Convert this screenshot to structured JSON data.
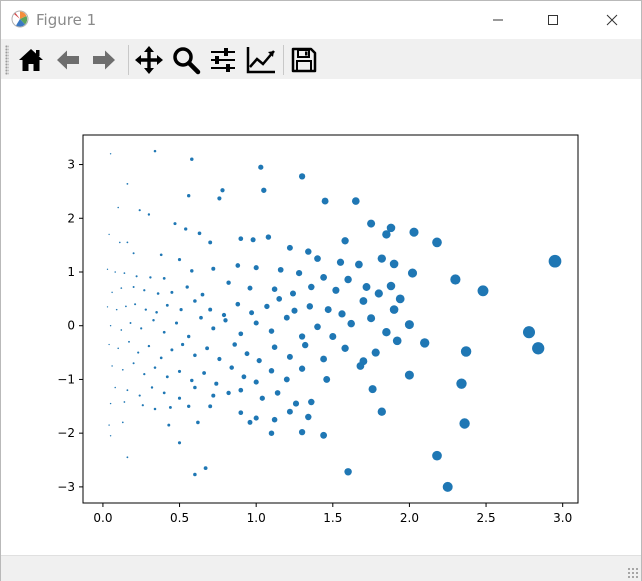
{
  "window": {
    "title": "Figure 1",
    "controls": [
      "minimize",
      "maximize",
      "close"
    ]
  },
  "toolbar": {
    "buttons": [
      {
        "name": "home",
        "icon": "home-icon",
        "tooltip": "Reset original view"
      },
      {
        "name": "back",
        "icon": "arrow-left-icon",
        "tooltip": "Back to previous view"
      },
      {
        "name": "forward",
        "icon": "arrow-right-icon",
        "tooltip": "Forward to next view"
      },
      {
        "name": "pan",
        "icon": "move-icon",
        "tooltip": "Pan axes"
      },
      {
        "name": "zoom",
        "icon": "magnifier-icon",
        "tooltip": "Zoom to rectangle"
      },
      {
        "name": "configure",
        "icon": "sliders-icon",
        "tooltip": "Configure subplots"
      },
      {
        "name": "edit",
        "icon": "line-chart-icon",
        "tooltip": "Edit axis"
      },
      {
        "name": "save",
        "icon": "floppy-disk-icon",
        "tooltip": "Save the figure"
      }
    ]
  },
  "colors": {
    "marker": "#1f77b4",
    "axes": "#000000",
    "toolbar_icons": "#000000",
    "disabled_icons": "#6e6e6e"
  },
  "chart_data": {
    "type": "scatter",
    "title": "",
    "xlabel": "",
    "ylabel": "",
    "xlim": [
      -0.13,
      3.1
    ],
    "ylim": [
      -3.3,
      3.55
    ],
    "xticks": [
      0.0,
      0.5,
      1.0,
      1.5,
      2.0,
      2.5,
      3.0
    ],
    "xtick_labels": [
      "0.0",
      "0.5",
      "1.0",
      "1.5",
      "2.0",
      "2.5",
      "3.0"
    ],
    "yticks": [
      -3,
      -2,
      -1,
      0,
      1,
      2,
      3
    ],
    "ytick_labels": [
      "−3",
      "−2",
      "−1",
      "0",
      "1",
      "2",
      "3"
    ],
    "grid": false,
    "marker_size_scales_with_x": true,
    "points": [
      [
        0.05,
        3.2
      ],
      [
        0.34,
        3.25
      ],
      [
        0.58,
        3.1
      ],
      [
        1.03,
        2.95
      ],
      [
        1.3,
        2.78
      ],
      [
        0.16,
        2.64
      ],
      [
        0.78,
        2.52
      ],
      [
        1.05,
        2.52
      ],
      [
        0.56,
        2.42
      ],
      [
        0.76,
        2.37
      ],
      [
        1.45,
        2.32
      ],
      [
        1.65,
        2.32
      ],
      [
        0.1,
        2.2
      ],
      [
        0.24,
        2.15
      ],
      [
        0.3,
        2.07
      ],
      [
        0.47,
        1.9
      ],
      [
        0.54,
        1.8
      ],
      [
        0.63,
        1.72
      ],
      [
        1.75,
        1.9
      ],
      [
        1.88,
        1.82
      ],
      [
        2.03,
        1.74
      ],
      [
        1.85,
        1.7
      ],
      [
        1.58,
        1.58
      ],
      [
        2.18,
        1.55
      ],
      [
        0.11,
        1.55
      ],
      [
        0.16,
        1.55
      ],
      [
        0.04,
        1.7
      ],
      [
        0.2,
        1.35
      ],
      [
        0.38,
        1.32
      ],
      [
        0.5,
        1.23
      ],
      [
        0.7,
        1.55
      ],
      [
        0.9,
        1.62
      ],
      [
        0.98,
        1.6
      ],
      [
        1.08,
        1.65
      ],
      [
        1.22,
        1.45
      ],
      [
        1.34,
        1.38
      ],
      [
        1.4,
        1.25
      ],
      [
        1.55,
        1.18
      ],
      [
        1.67,
        1.14
      ],
      [
        1.82,
        1.25
      ],
      [
        1.9,
        1.15
      ],
      [
        2.95,
        1.2
      ],
      [
        0.03,
        1.05
      ],
      [
        0.08,
        1.0
      ],
      [
        0.14,
        0.98
      ],
      [
        0.22,
        0.92
      ],
      [
        0.31,
        0.9
      ],
      [
        0.4,
        0.88
      ],
      [
        0.58,
        1.02
      ],
      [
        0.72,
        1.06
      ],
      [
        0.88,
        1.12
      ],
      [
        1.0,
        1.08
      ],
      [
        1.16,
        1.04
      ],
      [
        1.28,
        0.98
      ],
      [
        1.44,
        0.9
      ],
      [
        1.6,
        0.86
      ],
      [
        2.02,
        0.98
      ],
      [
        2.3,
        0.86
      ],
      [
        0.06,
        0.62
      ],
      [
        0.12,
        0.7
      ],
      [
        0.2,
        0.72
      ],
      [
        0.27,
        0.66
      ],
      [
        0.36,
        0.6
      ],
      [
        0.45,
        0.62
      ],
      [
        0.55,
        0.72
      ],
      [
        0.65,
        0.58
      ],
      [
        0.82,
        0.8
      ],
      [
        0.96,
        0.7
      ],
      [
        1.12,
        0.68
      ],
      [
        1.24,
        0.6
      ],
      [
        1.36,
        0.72
      ],
      [
        1.52,
        0.66
      ],
      [
        1.72,
        0.72
      ],
      [
        1.88,
        0.74
      ],
      [
        1.94,
        0.5
      ],
      [
        2.48,
        0.65
      ],
      [
        0.03,
        0.35
      ],
      [
        0.09,
        0.3
      ],
      [
        0.15,
        0.36
      ],
      [
        0.21,
        0.4
      ],
      [
        0.28,
        0.3
      ],
      [
        0.35,
        0.25
      ],
      [
        0.42,
        0.38
      ],
      [
        0.51,
        0.3
      ],
      [
        0.6,
        0.46
      ],
      [
        0.7,
        0.3
      ],
      [
        0.79,
        0.2
      ],
      [
        0.88,
        0.4
      ],
      [
        0.97,
        0.24
      ],
      [
        1.07,
        0.36
      ],
      [
        1.15,
        0.5
      ],
      [
        1.25,
        0.28
      ],
      [
        1.35,
        0.36
      ],
      [
        1.47,
        0.3
      ],
      [
        1.56,
        0.22
      ],
      [
        1.7,
        0.46
      ],
      [
        1.8,
        0.6
      ],
      [
        1.9,
        0.3
      ],
      [
        2.0,
        0.02
      ],
      [
        0.05,
        0.0
      ],
      [
        0.12,
        -0.08
      ],
      [
        0.18,
        0.05
      ],
      [
        0.25,
        -0.05
      ],
      [
        0.33,
        0.1
      ],
      [
        0.4,
        -0.12
      ],
      [
        0.48,
        0.05
      ],
      [
        0.56,
        -0.2
      ],
      [
        0.64,
        0.15
      ],
      [
        0.72,
        -0.05
      ],
      [
        0.8,
        0.1
      ],
      [
        0.9,
        -0.15
      ],
      [
        1.0,
        0.05
      ],
      [
        1.1,
        -0.1
      ],
      [
        1.2,
        0.15
      ],
      [
        1.3,
        -0.2
      ],
      [
        1.4,
        -0.02
      ],
      [
        1.5,
        -0.2
      ],
      [
        1.62,
        0.04
      ],
      [
        1.75,
        0.14
      ],
      [
        1.85,
        -0.12
      ],
      [
        2.1,
        -0.32
      ],
      [
        2.78,
        -0.12
      ],
      [
        0.04,
        -0.35
      ],
      [
        0.1,
        -0.42
      ],
      [
        0.17,
        -0.3
      ],
      [
        0.23,
        -0.5
      ],
      [
        0.3,
        -0.38
      ],
      [
        0.38,
        -0.6
      ],
      [
        0.45,
        -0.45
      ],
      [
        0.52,
        -0.35
      ],
      [
        0.6,
        -0.55
      ],
      [
        0.68,
        -0.42
      ],
      [
        0.76,
        -0.62
      ],
      [
        0.86,
        -0.35
      ],
      [
        0.94,
        -0.52
      ],
      [
        1.02,
        -0.65
      ],
      [
        1.12,
        -0.4
      ],
      [
        1.22,
        -0.58
      ],
      [
        1.32,
        -0.36
      ],
      [
        1.44,
        -0.62
      ],
      [
        1.58,
        -0.42
      ],
      [
        1.7,
        -0.66
      ],
      [
        1.78,
        -0.5
      ],
      [
        1.92,
        -0.28
      ],
      [
        2.37,
        -0.48
      ],
      [
        2.84,
        -0.42
      ],
      [
        0.06,
        -0.75
      ],
      [
        0.13,
        -0.82
      ],
      [
        0.2,
        -0.7
      ],
      [
        0.27,
        -0.9
      ],
      [
        0.34,
        -0.78
      ],
      [
        0.42,
        -0.95
      ],
      [
        0.5,
        -0.85
      ],
      [
        0.58,
        -1.02
      ],
      [
        0.66,
        -0.88
      ],
      [
        0.74,
        -1.08
      ],
      [
        0.84,
        -0.78
      ],
      [
        0.92,
        -0.95
      ],
      [
        1.0,
        -1.05
      ],
      [
        1.1,
        -0.84
      ],
      [
        1.2,
        -1.0
      ],
      [
        1.3,
        -0.8
      ],
      [
        1.46,
        -1.0
      ],
      [
        1.68,
        -0.75
      ],
      [
        2.0,
        -0.92
      ],
      [
        0.08,
        -1.15
      ],
      [
        0.16,
        -1.2
      ],
      [
        0.24,
        -1.3
      ],
      [
        0.32,
        -1.15
      ],
      [
        0.4,
        -1.25
      ],
      [
        0.5,
        -1.35
      ],
      [
        0.6,
        -1.15
      ],
      [
        0.72,
        -1.3
      ],
      [
        0.82,
        -1.25
      ],
      [
        0.9,
        -1.2
      ],
      [
        1.04,
        -1.35
      ],
      [
        1.14,
        -1.25
      ],
      [
        1.26,
        -1.45
      ],
      [
        1.36,
        -1.42
      ],
      [
        1.76,
        -1.18
      ],
      [
        2.34,
        -1.08
      ],
      [
        0.05,
        -1.45
      ],
      [
        0.14,
        -1.42
      ],
      [
        0.26,
        -1.48
      ],
      [
        0.34,
        -1.55
      ],
      [
        0.44,
        -1.52
      ],
      [
        0.56,
        -1.5
      ],
      [
        0.7,
        -1.5
      ],
      [
        0.9,
        -1.62
      ],
      [
        1.0,
        -1.72
      ],
      [
        1.12,
        -1.75
      ],
      [
        1.22,
        -1.6
      ],
      [
        1.34,
        -1.7
      ],
      [
        1.82,
        -1.6
      ],
      [
        2.36,
        -1.82
      ],
      [
        0.04,
        -1.85
      ],
      [
        0.13,
        -1.8
      ],
      [
        0.43,
        -1.85
      ],
      [
        0.62,
        -1.8
      ],
      [
        0.96,
        -1.8
      ],
      [
        1.1,
        -2.0
      ],
      [
        1.3,
        -1.98
      ],
      [
        1.44,
        -2.04
      ],
      [
        0.05,
        -2.05
      ],
      [
        0.5,
        -2.18
      ],
      [
        0.16,
        -2.45
      ],
      [
        2.18,
        -2.42
      ],
      [
        0.6,
        -2.77
      ],
      [
        0.67,
        -2.65
      ],
      [
        1.6,
        -2.72
      ],
      [
        2.25,
        -3.0
      ]
    ]
  }
}
